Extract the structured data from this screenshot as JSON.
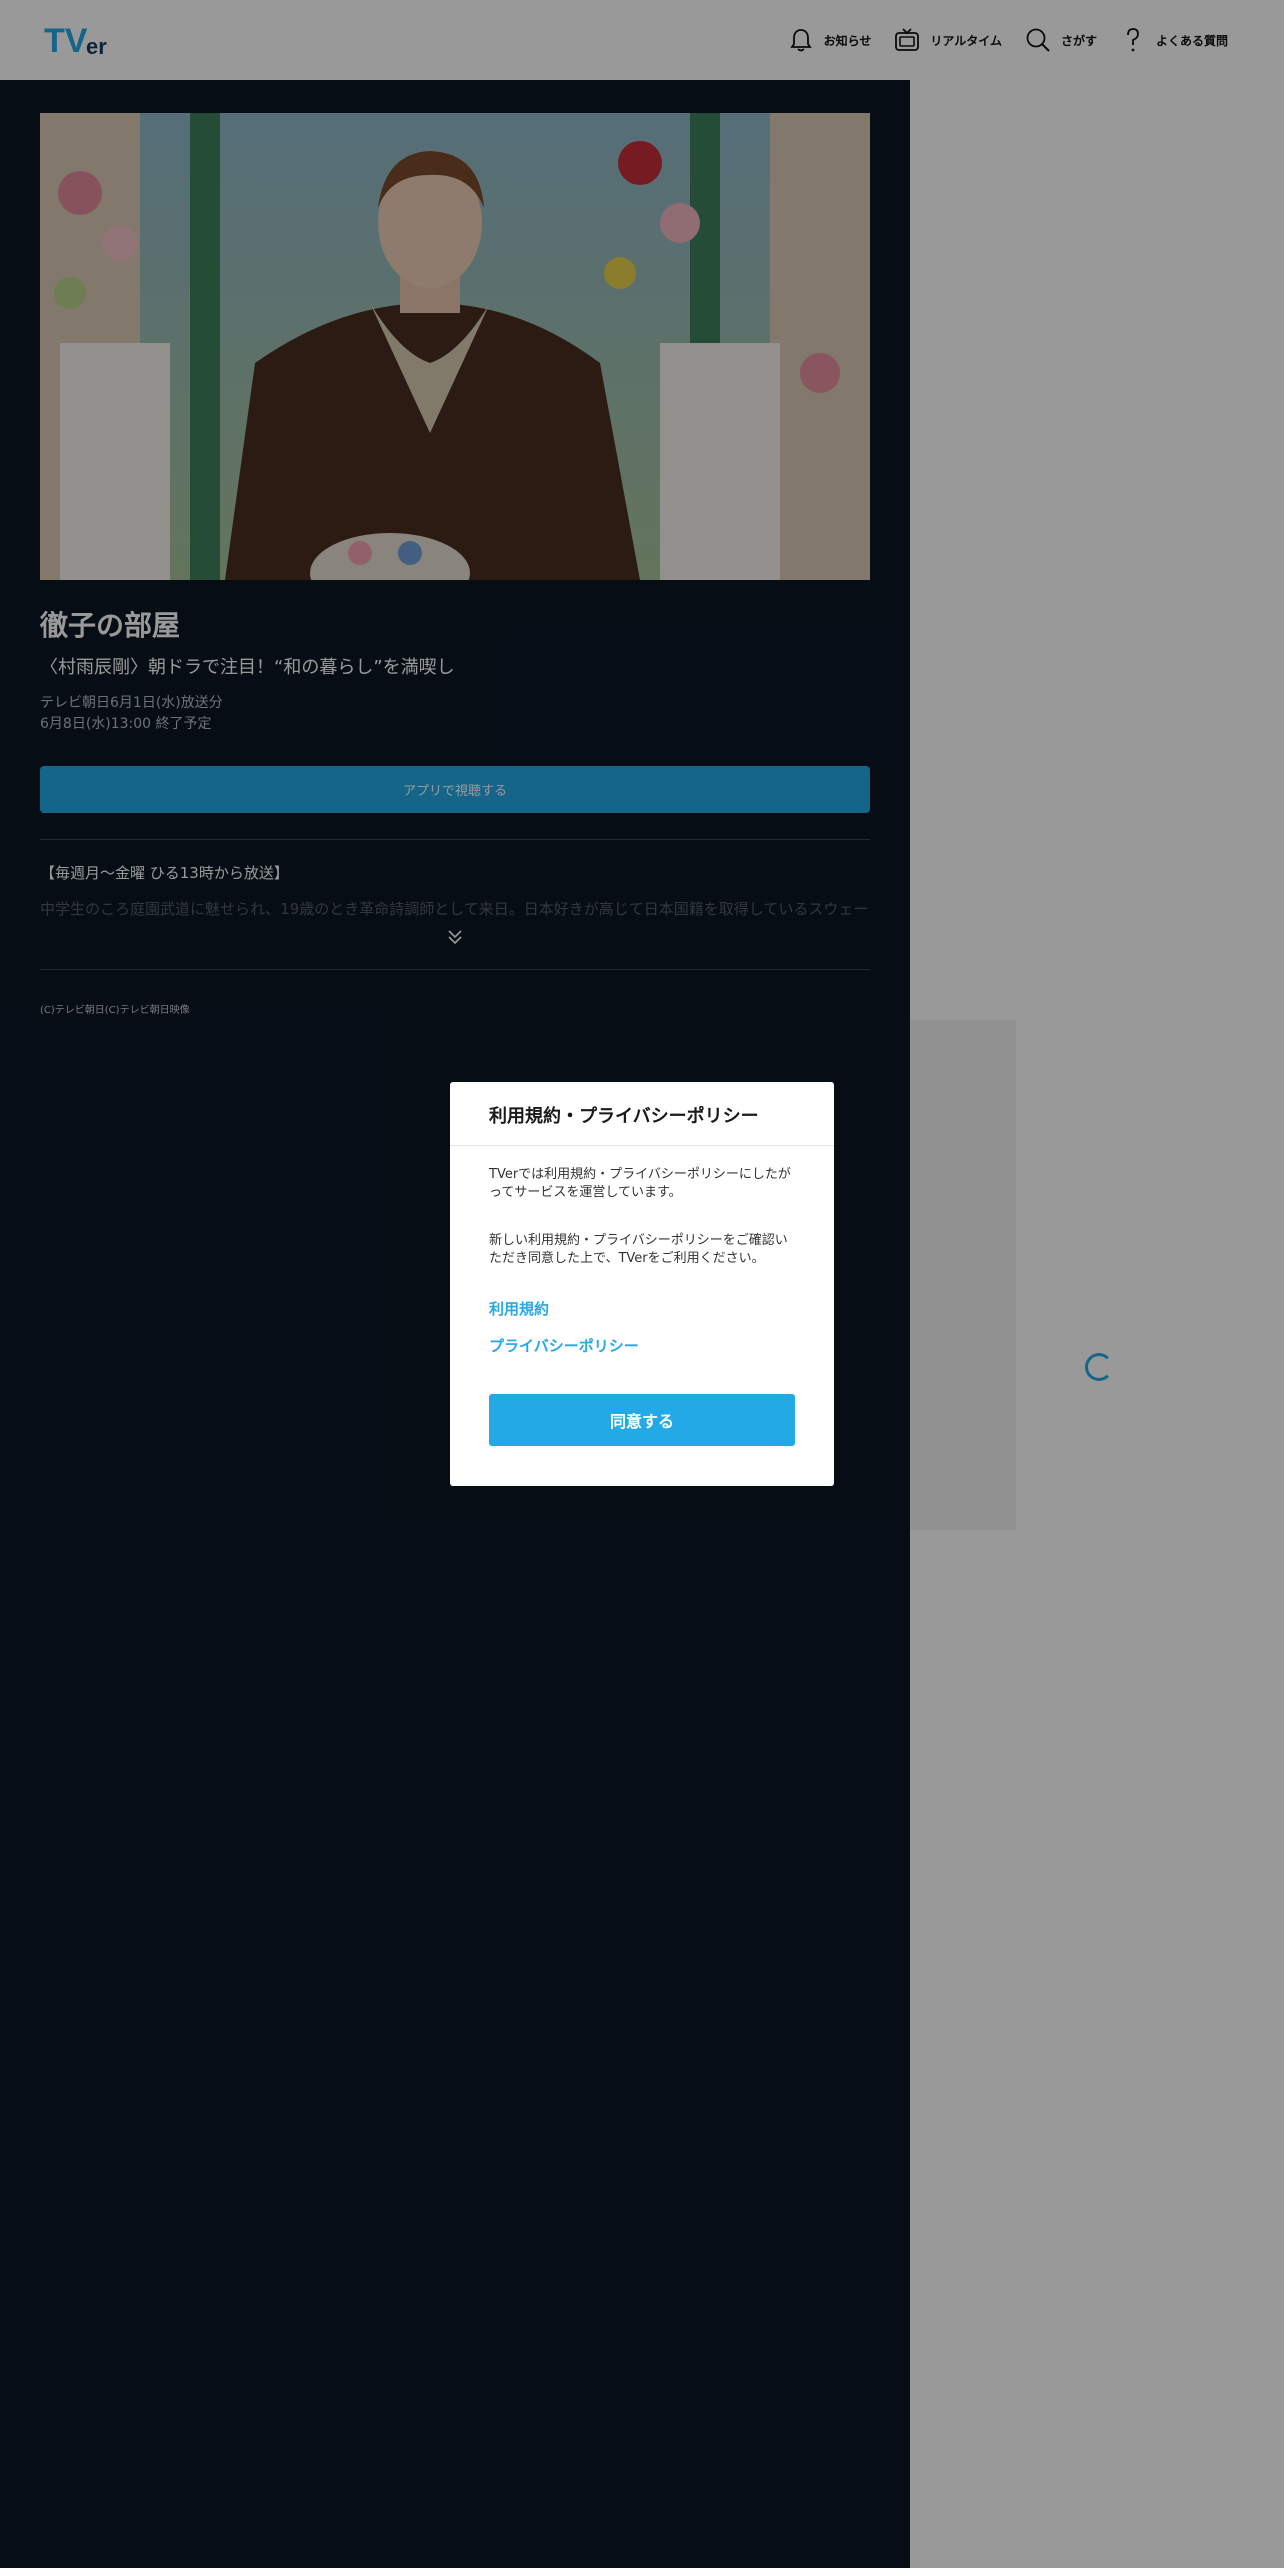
{
  "header": {
    "logo_text": "TVer",
    "nav": [
      {
        "icon": "bell-icon",
        "label": "お知らせ"
      },
      {
        "icon": "tv-icon",
        "label": "リアルタイム"
      },
      {
        "icon": "search-icon",
        "label": "さがす"
      },
      {
        "icon": "question-icon",
        "label": "よくある質問"
      }
    ]
  },
  "episode": {
    "title": "徹子の部屋",
    "subtitle": "〈村雨辰剛〉朝ドラで注目！“和の暮らし”を満喫し",
    "broadcast": "テレビ朝日6月1日(水)放送分",
    "expiry": "6月8日(水)13:00 終了予定",
    "watch_button": "アプリで視聴する",
    "description_line1": "【毎週月～金曜 ひる13時から放送】",
    "description_line2": "中学生のころ庭園武道に魅せられ、19歳のとき革命詩調師として来日。日本好きが高じて日本国籍を取得しているスウェー",
    "copyright": "(C)テレビ朝日(C)テレビ朝日映像"
  },
  "modal": {
    "title": "利用規約・プライバシーポリシー",
    "text1": "TVerでは利用規約・プライバシーポリシーにしたがってサービスを運営しています。",
    "text2": "新しい利用規約・プライバシーポリシーをご確認いただき同意した上で、TVerをご利用ください。",
    "link_terms": "利用規約",
    "link_privacy": "プライバシーポリシー",
    "agree_button": "同意する"
  },
  "colors": {
    "accent": "#23a9e6",
    "dark_bg": "#0c1624",
    "overlay": "rgba(0,0,0,0.4)"
  }
}
